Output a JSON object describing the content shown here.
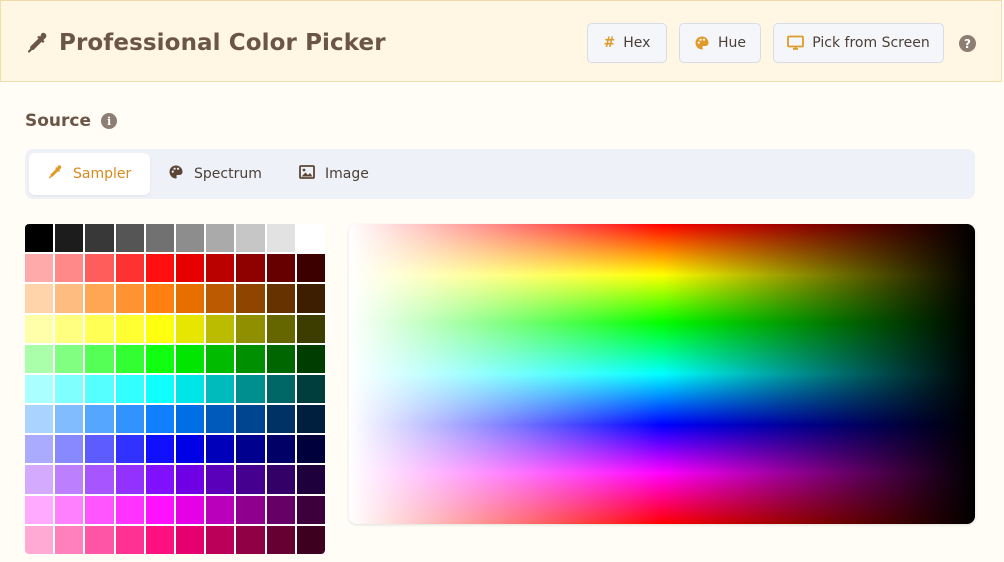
{
  "header": {
    "title": "Professional Color Picker",
    "title_icon": "eyedropper-icon",
    "buttons": [
      {
        "id": "hex",
        "label": "Hex",
        "icon": "hash-icon"
      },
      {
        "id": "hue",
        "label": "Hue",
        "icon": "palette-icon"
      },
      {
        "id": "pick",
        "label": "Pick from Screen",
        "icon": "monitor-icon"
      }
    ],
    "help_symbol": "?"
  },
  "source": {
    "title": "Source",
    "info_symbol": "i",
    "tabs": [
      {
        "label": "Sampler",
        "icon": "eyedropper-icon",
        "active": true
      },
      {
        "label": "Spectrum",
        "icon": "palette-icon",
        "active": false
      },
      {
        "label": "Image",
        "icon": "image-icon",
        "active": false
      }
    ]
  },
  "colors": {
    "accent": "#e09a2a",
    "active_tab_text": "#d88a1d",
    "header_bg": "#fff7e3",
    "page_bg": "#fffdf6"
  },
  "sampler_swatches": [
    [
      "#000000",
      "#1c1c1c",
      "#383838",
      "#555555",
      "#717171",
      "#8d8d8d",
      "#aaaaaa",
      "#c6c6c6",
      "#e2e2e2",
      "#ffffff"
    ],
    [
      "#ffaaaa",
      "#ff8888",
      "#ff5c5c",
      "#ff3232",
      "#ff1010",
      "#e60000",
      "#bb0000",
      "#8f0000",
      "#660000",
      "#3d0000"
    ],
    [
      "#ffd4aa",
      "#ffbc80",
      "#ffa655",
      "#ff9332",
      "#ff8010",
      "#e66f00",
      "#bb5a00",
      "#8f4500",
      "#663200",
      "#3d1e00"
    ],
    [
      "#ffffaa",
      "#ffff80",
      "#ffff55",
      "#ffff32",
      "#ffff10",
      "#e6e600",
      "#bbbb00",
      "#8f8f00",
      "#666600",
      "#3d3d00"
    ],
    [
      "#aaffaa",
      "#80ff80",
      "#55ff55",
      "#32ff32",
      "#10ff10",
      "#00e600",
      "#00bb00",
      "#008f00",
      "#006600",
      "#003d00"
    ],
    [
      "#aaffff",
      "#80ffff",
      "#55ffff",
      "#32ffff",
      "#10ffff",
      "#00e6e6",
      "#00bbbb",
      "#008f8f",
      "#006666",
      "#003d3d"
    ],
    [
      "#aad4ff",
      "#80bcff",
      "#55a6ff",
      "#3293ff",
      "#1080ff",
      "#006fe6",
      "#005abb",
      "#00458f",
      "#003266",
      "#001e3d"
    ],
    [
      "#aaaaff",
      "#8888ff",
      "#5c5cff",
      "#3232ff",
      "#1010ff",
      "#0000e6",
      "#0000bb",
      "#00008f",
      "#000066",
      "#00003d"
    ],
    [
      "#d4aaff",
      "#bc80ff",
      "#a655ff",
      "#9332ff",
      "#8010ff",
      "#6f00e6",
      "#5a00bb",
      "#45008f",
      "#320066",
      "#1e003d"
    ],
    [
      "#ffaaff",
      "#ff80ff",
      "#ff55ff",
      "#ff32ff",
      "#ff10ff",
      "#e600e6",
      "#bb00bb",
      "#8f008f",
      "#660066",
      "#3d003d"
    ],
    [
      "#ffaad4",
      "#ff80bc",
      "#ff55a6",
      "#ff3293",
      "#ff1080",
      "#e6006f",
      "#bb005a",
      "#8f0045",
      "#660032",
      "#3d001e"
    ]
  ]
}
